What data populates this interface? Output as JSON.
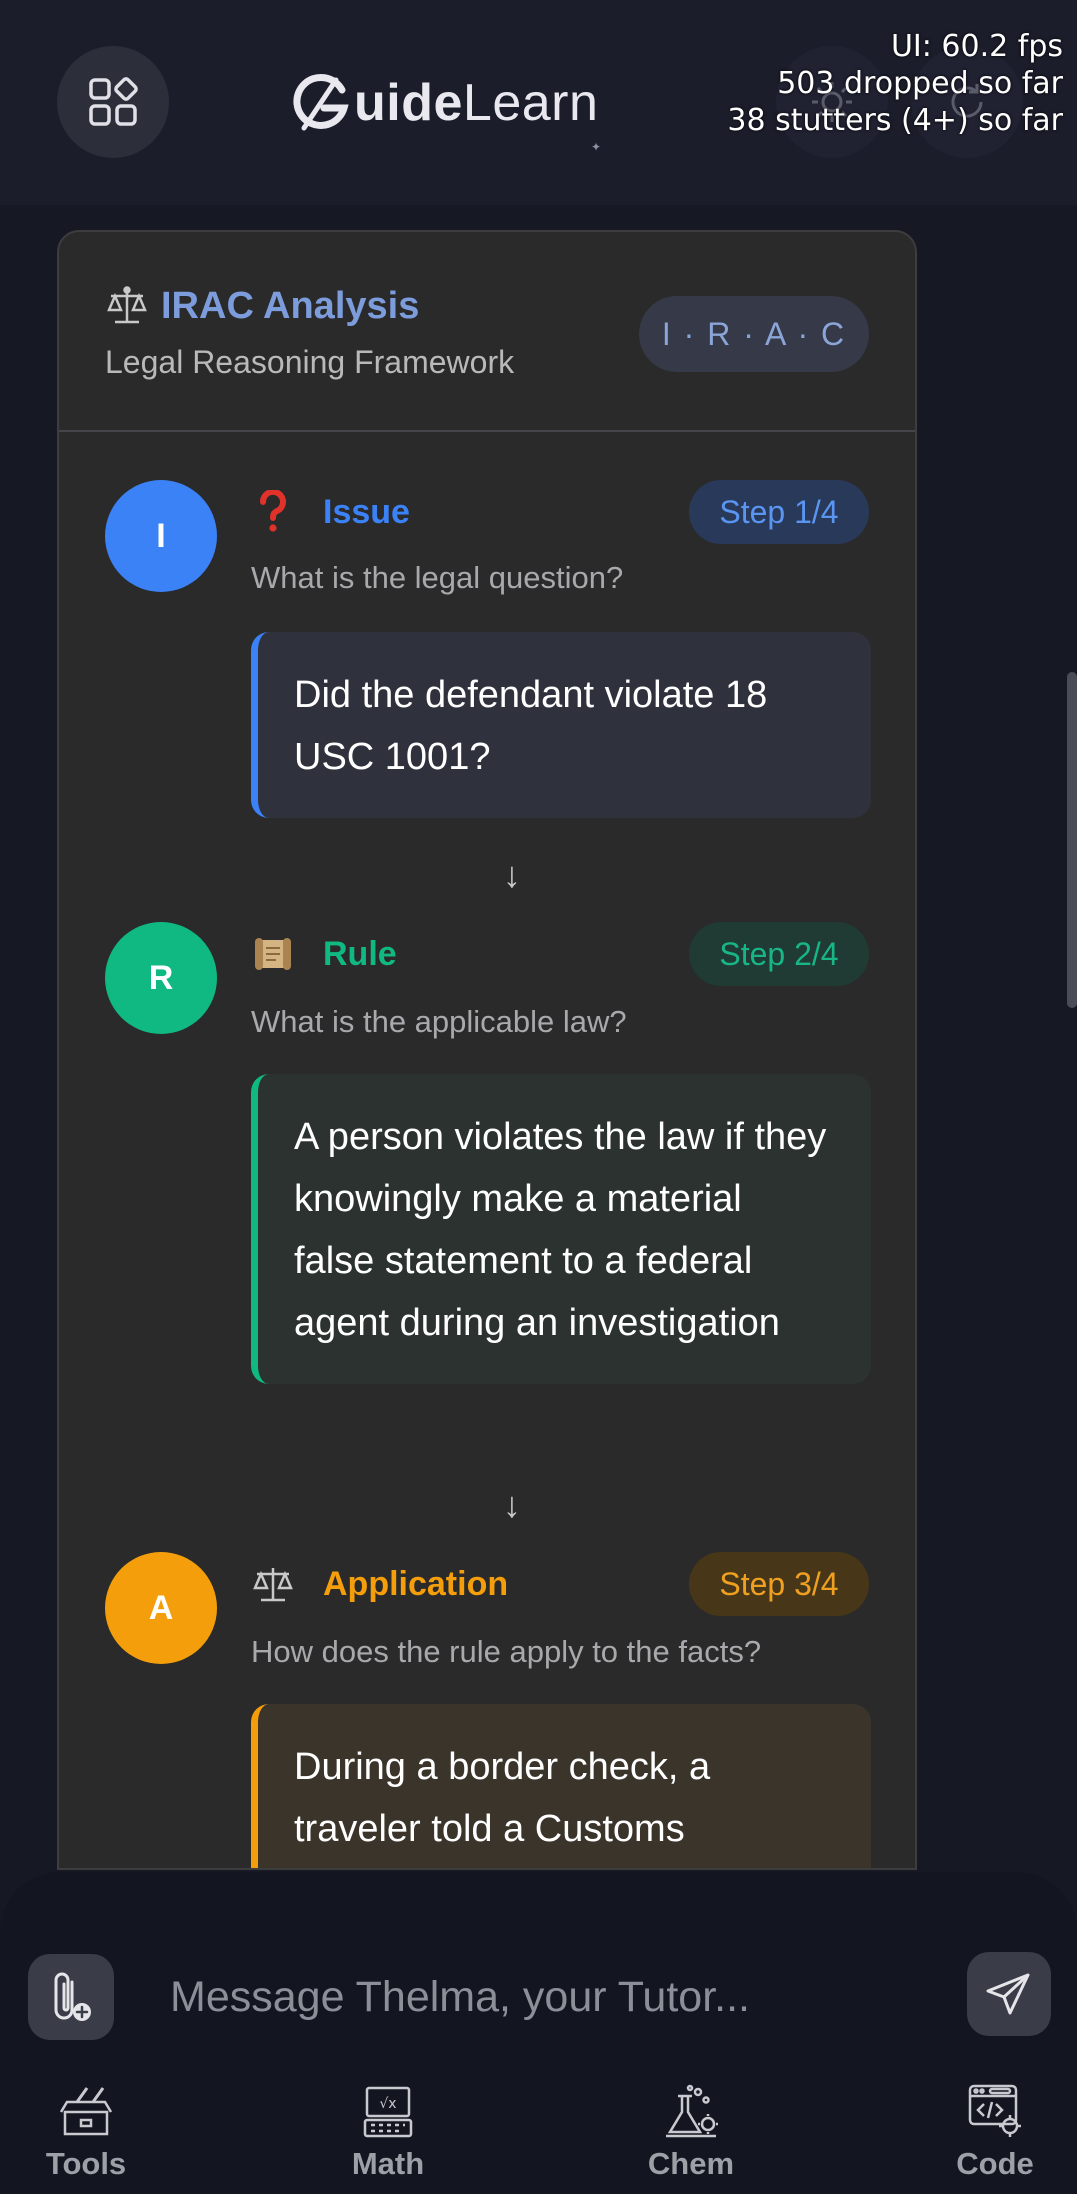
{
  "header": {
    "logo_text_bold": "uide",
    "logo_text_light": "Learn",
    "apps_icon": "apps-grid-icon",
    "theme_icon": "sun-icon",
    "refresh_icon": "refresh-icon"
  },
  "perf_overlay": {
    "line1": "UI: 60.2 fps",
    "line2": "503 dropped so far",
    "line3": "38 stutters (4+) so far"
  },
  "card": {
    "title": "IRAC Analysis",
    "subtitle": "Legal Reasoning Framework",
    "badge": "I · R · A · C",
    "title_icon": "scale-icon"
  },
  "steps": [
    {
      "letter": "I",
      "name": "Issue",
      "step_label": "Step 1/4",
      "question": "What is the legal question?",
      "answer": "Did the defendant violate 18 USC 1001?",
      "icon": "question-mark-icon",
      "color": "#3b82f6"
    },
    {
      "letter": "R",
      "name": "Rule",
      "step_label": "Step 2/4",
      "question": "What is the applicable law?",
      "answer": "A person violates the law if they knowingly make a material false statement to a federal agent during an investigation",
      "icon": "scroll-icon",
      "color": "#10b981"
    },
    {
      "letter": "A",
      "name": "Application",
      "step_label": "Step 3/4",
      "question": "How does the rule apply to the facts?",
      "answer": "During a border check, a traveler told a Customs",
      "icon": "scale-icon",
      "color": "#f59e0b"
    }
  ],
  "arrows": [
    "↓",
    "↓"
  ],
  "composer": {
    "placeholder": "Message Thelma, your Tutor...",
    "attach_icon": "paperclip-add-icon",
    "send_icon": "send-icon"
  },
  "bottom_nav": [
    {
      "label": "Tools",
      "icon": "toolbox-icon"
    },
    {
      "label": "Math",
      "icon": "calculator-icon"
    },
    {
      "label": "Chem",
      "icon": "flask-icon"
    },
    {
      "label": "Code",
      "icon": "code-window-icon"
    }
  ]
}
